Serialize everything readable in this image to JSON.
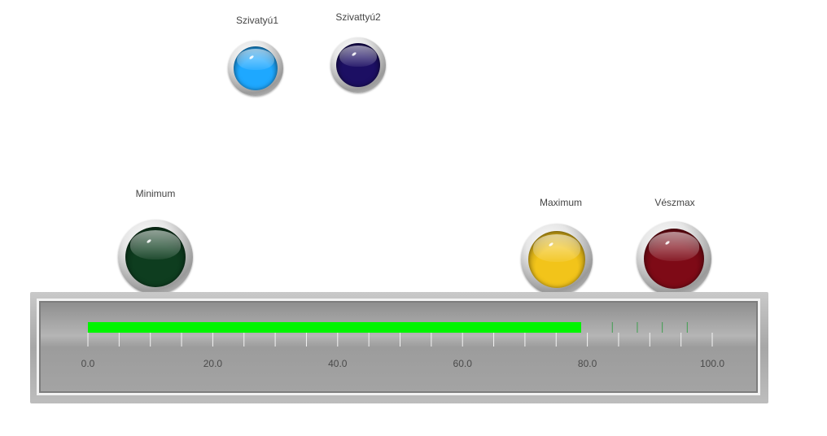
{
  "pumps": [
    {
      "label": "Szivatyú1",
      "color": "#1ea8ff",
      "state": "on"
    },
    {
      "label": "Szivattyú2",
      "color": "#1c0f63",
      "state": "off"
    }
  ],
  "level_lamps": [
    {
      "label": "Minimum",
      "color": "#0e3d1f",
      "state": "off"
    },
    {
      "label": "Maximum",
      "color": "#f2c41a",
      "state": "on"
    },
    {
      "label": "Vészmax",
      "color": "#7e0a16",
      "state": "on"
    }
  ],
  "gauge": {
    "min": 0,
    "max": 100,
    "value": 79,
    "bar_color": "#00f500",
    "setpoint_color": "#3f9f4f",
    "setpoint_marks": [
      84,
      88,
      92,
      96
    ],
    "tick_labels": [
      "0.0",
      "20.0",
      "40.0",
      "60.0",
      "80.0",
      "100.0"
    ],
    "tick_values": [
      0,
      20,
      40,
      60,
      80,
      100
    ],
    "minor_step": 5
  }
}
